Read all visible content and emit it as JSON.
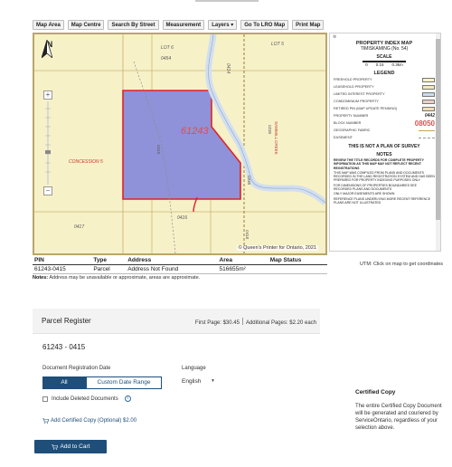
{
  "toolbar": {
    "map_area": "Map Area",
    "map_centre": "Map Centre",
    "search_by_street": "Search By Street",
    "measurement": "Measurement",
    "layers": "Layers",
    "go_to_lro_map": "Go To LRO Map",
    "print_map": "Print Map"
  },
  "map": {
    "north_label": "N",
    "labels": {
      "lot6": "LOT 6",
      "lot5": "LOT 5",
      "concession": "CONCESSION 5",
      "n0454": "0454",
      "n0414": "0414",
      "n0415": "0415",
      "n0416": "0416",
      "n0417": "0417",
      "n0418": "0418",
      "n0413": "0413",
      "block": "61243",
      "river": "SAWMILL CREEK",
      "n0236": "0236",
      "n0238": "0238",
      "n0432": "0432",
      "zoom_plus": "+",
      "zoom_minus": "−"
    },
    "copyright": "© Queen's Printer for Ontario, 2021"
  },
  "legend": {
    "close": "⊗",
    "title": "PROPERTY INDEX MAP",
    "subtitle": "TIMISKAMING (No. 54)",
    "scale_title": "SCALE",
    "scale_marks": [
      "0",
      "0.15",
      "0.3km"
    ],
    "legend_title": "LEGEND",
    "items": [
      {
        "label": "FREEHOLD PROPERTY",
        "color": "#f7f1c8"
      },
      {
        "label": "LEASEHOLD PROPERTY",
        "color": "#f5e9b8"
      },
      {
        "label": "LIMITED INTEREST PROPERTY",
        "color": "#c9dced"
      },
      {
        "label": "CONDOMINIUM PROPERTY",
        "color": "#ecd0c6"
      },
      {
        "label": "RETIRED PIN (MAP UPDATE PENDING)",
        "color": "#f4ddb6"
      }
    ],
    "property_number_label": "PROPERTY NUMBER",
    "property_number_value": "0442",
    "block_number_label": "BLOCK NUMBER",
    "block_number_value": "08050",
    "geographic_fabric_label": "GEOGRAPHIC FABRIC",
    "easement_label": "EASEMENT",
    "not_a_plan": "THIS IS NOT A PLAN OF SURVEY",
    "notes_title": "NOTES",
    "notes": [
      "REVIEW THE TITLE RECORDS FOR COMPLETE PROPERTY INFORMATION AS THIS MAP MAY NOT REFLECT RECENT REGISTRATIONS",
      "THIS MAP WAS COMPILED FROM PLANS AND DOCUMENTS RECORDED IN THE LAND REGISTRATION SYSTEM AND HAS BEEN PREPARED FOR PROPERTY INDEXING PURPOSES ONLY",
      "FOR DIMENSIONS OF PROPERTIES BOUNDARIES SEE RECORDED PLANS AND DOCUMENTS",
      "ONLY MAJOR EASEMENTS ARE SHOWN",
      "REFERENCE PLANS UNDERLYING MORE RECENT REFERENCE PLANS ARE NOT ILLUSTRATED"
    ]
  },
  "table": {
    "headers": [
      "PIN",
      "Type",
      "Address",
      "Area",
      "Map Status"
    ],
    "row": [
      "61243-0415",
      "Parcel",
      "Address Not Found",
      "516655m²",
      ""
    ]
  },
  "utm": "UTM: Click on map to get coordinates",
  "notes": {
    "label": "Notes:",
    "text": " Address may be unavailable or approximate, areas are approximate."
  },
  "parcel_register": {
    "title": "Parcel Register",
    "first_page": "First Page: $30.45",
    "additional_pages": "Additional Pages: $2.20 each",
    "pin": "61243 - 0415",
    "doc_date_label": "Document Registration Date",
    "doc_date_all": "All",
    "doc_date_custom": "Custom Date Range",
    "language_label": "Language",
    "language_value": "English",
    "include_deleted": "Include Deleted Documents",
    "add_certified": "Add Certified Copy (Optional) $2.00",
    "add_to_cart": "Add to Cart"
  },
  "certified_copy": {
    "title": "Certified Copy",
    "text": "The entire Certified Copy Document will be generated and couriered by ServiceOntario, regardless of your selection above."
  },
  "colors": {
    "accent": "#1f4e79",
    "map_bg": "#f7f1c8",
    "parcel_fill": "#8f92d8",
    "parcel_stroke": "#e0202a",
    "river": "#d2dff0"
  }
}
